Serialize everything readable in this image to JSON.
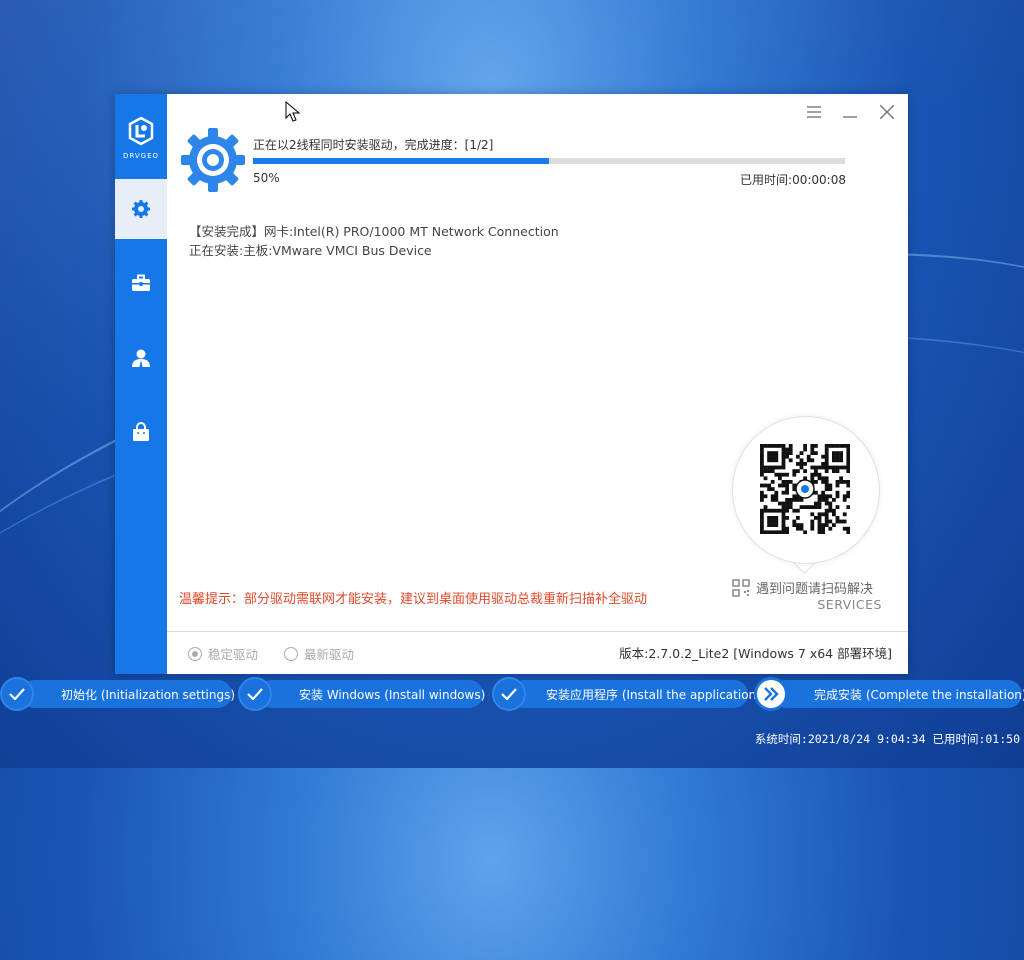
{
  "app": {
    "logo_text": "DRVGEO"
  },
  "install": {
    "status": "正在以2线程同时安装驱动，完成进度：[1/2]",
    "progress": 0.5,
    "percent_label": "50%",
    "elapsed": "已用时间:00:00:08",
    "log": [
      "【安装完成】网卡:Intel(R) PRO/1000 MT Network Connection",
      "正在安装:主板:VMware VMCI Bus Device"
    ]
  },
  "tip": "温馨提示：部分驱动需联网才能安装，建议到桌面使用驱动总裁重新扫描补全驱动",
  "qr": {
    "label": "遇到问题请扫码解决",
    "services": "SERVICES"
  },
  "options": {
    "stable": "稳定驱动",
    "latest": "最新驱动"
  },
  "version": "版本:2.7.0.2_Lite2 [Windows 7 x64 部署环境]",
  "steps": [
    {
      "label": "初始化 (Initialization settings)",
      "status": "done"
    },
    {
      "label": "安装 Windows (Install windows)",
      "status": "done"
    },
    {
      "label": "安装应用程序 (Install the application)",
      "status": "done"
    },
    {
      "label": "完成安装 (Complete the installation)",
      "status": "current"
    }
  ],
  "system_time": "系统时间:2021/8/24 9:04:34 已用时间:01:50",
  "colors": {
    "accent": "#1677e8",
    "tip": "#e04a2a",
    "step_band": "#1a72dc"
  }
}
